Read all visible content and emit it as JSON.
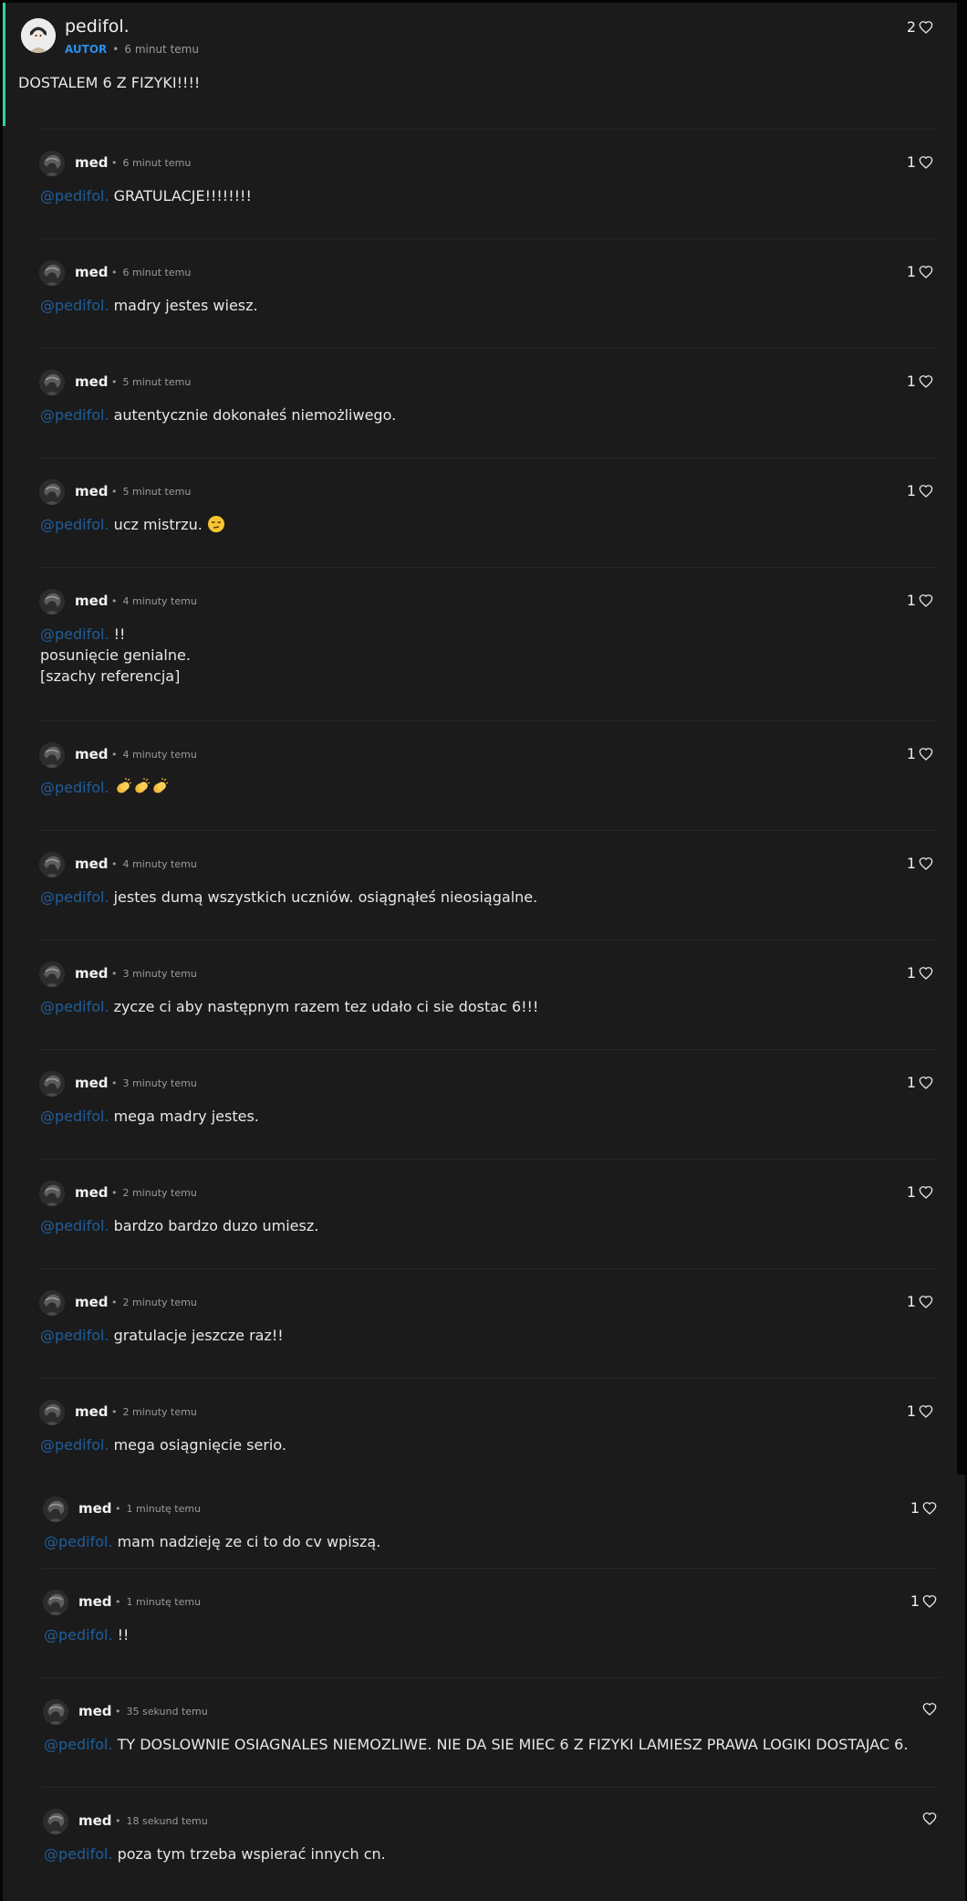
{
  "post": {
    "author": "pedifol.",
    "badge": "AUTOR",
    "time": "6 minut temu",
    "text": "DOSTALEM 6 Z FIZYKI!!!!",
    "likes": "2"
  },
  "mention": "@pedifol.",
  "replies": [
    {
      "author": "med",
      "time": "6 minut temu",
      "text": "GRATULACJE!!!!!!!!",
      "likes": "1"
    },
    {
      "author": "med",
      "time": "6 minut temu",
      "text": "madry jestes wiesz.",
      "likes": "1"
    },
    {
      "author": "med",
      "time": "5 minut temu",
      "text": "autentycznie dokonałeś niemożliwego.",
      "likes": "1"
    },
    {
      "author": "med",
      "time": "5 minut temu",
      "text": "ucz mistrzu.",
      "emoji": [
        "unamused-face-emoji"
      ],
      "likes": "1"
    },
    {
      "author": "med",
      "time": "4 minuty temu",
      "text": "!!",
      "extra_lines": [
        "posunięcie genialne.",
        "[szachy referencja]"
      ],
      "likes": "1"
    },
    {
      "author": "med",
      "time": "4 minuty temu",
      "text": "",
      "emoji": [
        "clapping-hands-emoji",
        "clapping-hands-emoji",
        "clapping-hands-emoji"
      ],
      "likes": "1"
    },
    {
      "author": "med",
      "time": "4 minuty temu",
      "text": "jestes dumą wszystkich uczniów. osiągnąłeś nieosiągalne.",
      "likes": "1"
    },
    {
      "author": "med",
      "time": "3 minuty temu",
      "text": "zycze ci aby następnym razem tez udało ci sie dostac 6!!!",
      "likes": "1"
    },
    {
      "author": "med",
      "time": "3 minuty temu",
      "text": "mega madry jestes.",
      "likes": "1"
    },
    {
      "author": "med",
      "time": "2 minuty temu",
      "text": "bardzo bardzo duzo umiesz.",
      "likes": "1"
    },
    {
      "author": "med",
      "time": "2 minuty temu",
      "text": "gratulacje jeszcze raz!!",
      "likes": "1"
    },
    {
      "author": "med",
      "time": "2 minuty temu",
      "text": "mega osiągnięcie serio.",
      "likes": "1"
    },
    {
      "author": "med",
      "time": "1 minutę temu",
      "text": "mam nadzieję ze ci to do cv wpiszą.",
      "likes": "1"
    },
    {
      "author": "med",
      "time": "1 minutę temu",
      "text": "!!",
      "likes": "1"
    },
    {
      "author": "med",
      "time": "35 sekund temu",
      "text": "TY DOSLOWNIE OSIAGNALES NIEMOZLIWE. NIE DA SIE MIEC 6 Z FIZYKI LAMIESZ PRAWA LOGIKI DOSTAJAC 6.",
      "likes": ""
    },
    {
      "author": "med",
      "time": "18 sekund temu",
      "text": "poza tym trzeba wspierać innych cn.",
      "likes": ""
    }
  ],
  "colors": {
    "background": "#050505",
    "panel": "#1b1b1b",
    "accent": "#34d1a7",
    "badge": "#2a8ee6",
    "mention": "#1f5e9c"
  }
}
